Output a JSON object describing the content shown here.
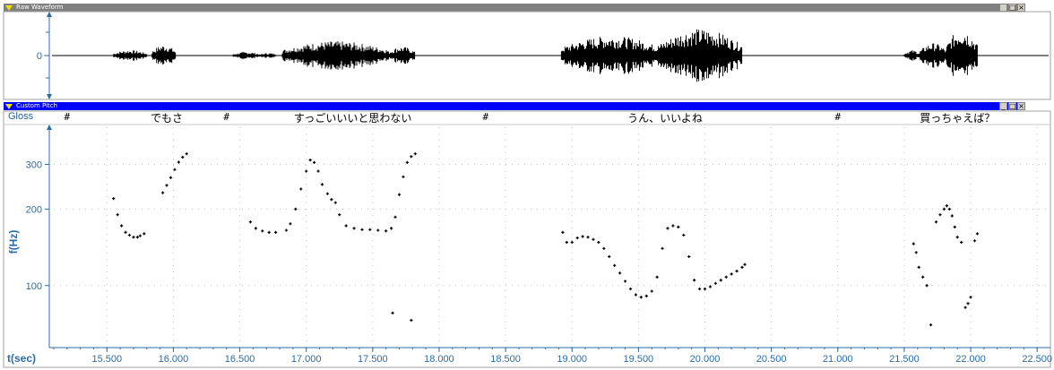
{
  "waveform_panel": {
    "title": "Raw Waveform",
    "zero_label": "0",
    "window_buttons": [
      "_",
      "□",
      "×"
    ]
  },
  "pitch_panel": {
    "title": "Custom Pitch",
    "window_buttons": [
      "_",
      "□",
      "×"
    ]
  },
  "gloss": {
    "label": "Gloss",
    "separator": "#",
    "segments": [
      {
        "text": "でもさ",
        "time": 15.95
      },
      {
        "text": "すっごいいいと思わない",
        "time": 17.35
      },
      {
        "text": "うん、いいよね",
        "time": 19.7
      },
      {
        "text": "買っちゃえば？",
        "time": 21.9
      }
    ],
    "boundaries": [
      15.2,
      16.4,
      18.35,
      21.0
    ]
  },
  "colors": {
    "title_active": "#0000ff",
    "title_inactive": "#808080",
    "axis": "#2b6ca8",
    "data": "#000000"
  },
  "chart_data": {
    "type": "scatter",
    "title": "",
    "xlabel": "t(sec)",
    "ylabel": "f(Hz)",
    "xlim": [
      15.1,
      22.6
    ],
    "ylim": [
      57,
      420
    ],
    "y_scale": "log",
    "x_ticks": [
      "15.500",
      "16.000",
      "16.500",
      "17.000",
      "17.500",
      "18.000",
      "18.500",
      "19.000",
      "19.500",
      "20.000",
      "20.500",
      "21.000",
      "21.500",
      "22.000",
      "22.500"
    ],
    "y_ticks": [
      "100",
      "200",
      "300"
    ],
    "grid": "dotted",
    "series": [
      {
        "x": [
          15.55,
          15.58,
          15.61,
          15.64,
          15.67,
          15.7,
          15.73,
          15.75,
          15.78,
          15.92,
          15.95,
          15.98,
          16.01,
          16.04,
          16.07,
          16.1,
          16.58,
          16.62,
          16.67,
          16.72,
          16.77,
          16.85,
          16.88,
          16.92,
          16.96,
          17.0,
          17.03,
          17.06,
          17.09,
          17.12,
          17.16,
          17.19,
          17.22,
          17.25,
          17.3,
          17.36,
          17.42,
          17.48,
          17.54,
          17.6,
          17.64,
          17.67,
          17.7,
          17.73,
          17.76,
          17.79,
          17.82,
          17.65,
          17.79,
          18.93,
          18.96,
          19.0,
          19.04,
          19.08,
          19.12,
          19.16,
          19.2,
          19.24,
          19.28,
          19.32,
          19.36,
          19.4,
          19.44,
          19.48,
          19.52,
          19.56,
          19.6,
          19.64,
          19.68,
          19.72,
          19.76,
          19.8,
          19.84,
          19.88,
          19.92,
          19.96,
          20.0,
          20.04,
          20.08,
          20.12,
          20.16,
          20.2,
          20.24,
          20.28,
          20.3,
          21.57,
          21.59,
          21.61,
          21.64,
          21.67,
          21.7,
          21.74,
          21.77,
          21.8,
          21.82,
          21.84,
          21.86,
          21.88,
          21.9,
          21.93,
          21.96,
          21.98,
          22.0,
          22.03,
          22.05
        ],
        "y": [
          220,
          190,
          172,
          162,
          158,
          155,
          155,
          157,
          160,
          232,
          248,
          266,
          286,
          306,
          320,
          330,
          178,
          168,
          164,
          162,
          162,
          165,
          175,
          200,
          240,
          282,
          312,
          305,
          282,
          250,
          230,
          218,
          212,
          190,
          172,
          168,
          166,
          166,
          165,
          164,
          168,
          186,
          228,
          268,
          305,
          322,
          330,
          78,
          73,
          162,
          148,
          148,
          154,
          156,
          155,
          152,
          148,
          140,
          130,
          120,
          112,
          104,
          97,
          92,
          90,
          91,
          95,
          108,
          140,
          168,
          172,
          170,
          158,
          130,
          105,
          97,
          97,
          99,
          102,
          105,
          108,
          111,
          114,
          118,
          121,
          146,
          135,
          118,
          108,
          100,
          70,
          178,
          190,
          200,
          206,
          200,
          188,
          170,
          155,
          148,
          82,
          85,
          90,
          150,
          160
        ],
        "name": ""
      }
    ]
  }
}
